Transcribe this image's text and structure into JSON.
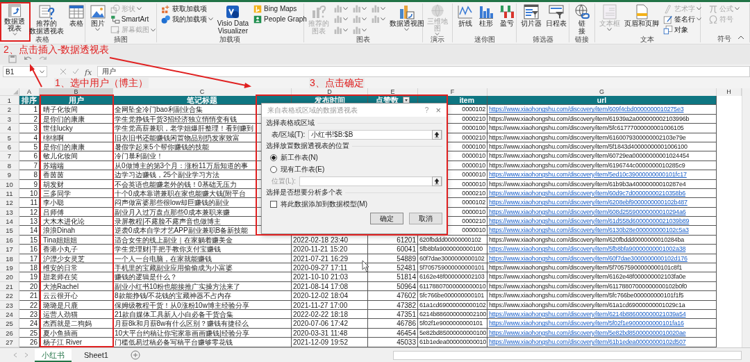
{
  "ribbon": {
    "groups": [
      {
        "label": "表格",
        "items": [
          {
            "kind": "large",
            "lines": [
              "数据透",
              "视表"
            ],
            "disabled": false,
            "menu": true
          },
          {
            "kind": "large",
            "lines": [
              "推荐的",
              "数据透视表"
            ],
            "disabled": false,
            "menu": false
          },
          {
            "kind": "large",
            "lines": [
              "表格"
            ],
            "disabled": false,
            "menu": false
          }
        ]
      },
      {
        "label": "插图",
        "items": [
          {
            "kind": "large",
            "lines": [
              "图片"
            ],
            "disabled": false,
            "menu": true
          },
          {
            "kind": "small",
            "label": "形状",
            "disabled": true,
            "menu": true
          },
          {
            "kind": "small",
            "label": "SmartArt",
            "disabled": false,
            "menu": false
          },
          {
            "kind": "small",
            "label": "屏幕截图",
            "disabled": true,
            "menu": true
          }
        ]
      },
      {
        "label": "加载项",
        "items": [
          {
            "kind": "small",
            "label": "获取加载项",
            "disabled": false,
            "menu": false
          },
          {
            "kind": "small",
            "label": "我的加载项",
            "disabled": false,
            "menu": true
          },
          {
            "kind": "large",
            "lines": [
              "Visio Data",
              "Visualizer"
            ],
            "disabled": false,
            "menu": false
          },
          {
            "kind": "small",
            "label": "Bing Maps",
            "disabled": false,
            "menu": false
          },
          {
            "kind": "small",
            "label": "People Graph",
            "disabled": false,
            "menu": false
          }
        ]
      },
      {
        "label": "图表",
        "items": [
          {
            "kind": "large",
            "lines": [
              "推荐的",
              "图表"
            ],
            "disabled": true,
            "menu": false
          },
          {
            "kind": "chart-menu",
            "disabled": true,
            "menu": true
          },
          {
            "kind": "chart-menu",
            "disabled": true,
            "menu": true
          },
          {
            "kind": "chart-menu",
            "disabled": true,
            "menu": true
          },
          {
            "kind": "chart-menu",
            "disabled": true,
            "menu": true
          },
          {
            "kind": "chart-menu",
            "disabled": true,
            "menu": true
          },
          {
            "kind": "chart-menu",
            "disabled": true,
            "menu": true
          },
          {
            "kind": "chart-menu",
            "disabled": true,
            "menu": true
          },
          {
            "kind": "chart-menu",
            "disabled": true,
            "menu": true
          },
          {
            "kind": "large",
            "lines": [
              "数据透视图"
            ],
            "disabled": false,
            "menu": true
          }
        ]
      },
      {
        "label": "演示",
        "items": [
          {
            "kind": "large",
            "lines": [
              "三维地",
              "图"
            ],
            "disabled": true,
            "menu": true
          }
        ]
      },
      {
        "label": "迷你图",
        "items": [
          {
            "kind": "large",
            "lines": [
              "折线"
            ],
            "disabled": false,
            "menu": false
          },
          {
            "kind": "large",
            "lines": [
              "柱形"
            ],
            "disabled": false,
            "menu": false
          },
          {
            "kind": "large",
            "lines": [
              "盈亏"
            ],
            "disabled": false,
            "menu": false
          }
        ]
      },
      {
        "label": "筛选器",
        "items": [
          {
            "kind": "large",
            "lines": [
              "切片器"
            ],
            "disabled": false,
            "menu": false
          },
          {
            "kind": "large",
            "lines": [
              "日程表"
            ],
            "disabled": false,
            "menu": false
          }
        ]
      },
      {
        "label": "链接",
        "items": [
          {
            "kind": "large",
            "lines": [
              "链",
              "接"
            ],
            "disabled": false,
            "menu": false
          }
        ]
      },
      {
        "label": "文本",
        "items": [
          {
            "kind": "large",
            "lines": [
              "文本框"
            ],
            "disabled": true,
            "menu": true
          },
          {
            "kind": "large",
            "lines": [
              "页眉和页脚"
            ],
            "disabled": false,
            "menu": false
          },
          {
            "kind": "small",
            "label": "艺术字",
            "disabled": true,
            "menu": true
          },
          {
            "kind": "small",
            "label": "签名行",
            "disabled": false,
            "menu": true
          },
          {
            "kind": "small",
            "label": "对象",
            "disabled": false,
            "menu": false
          }
        ]
      },
      {
        "label": "符号",
        "items": [
          {
            "kind": "small",
            "label": "公式",
            "disabled": true,
            "menu": true
          },
          {
            "kind": "small",
            "label": "符号",
            "disabled": true,
            "menu": false
          }
        ]
      }
    ]
  },
  "formula_bar": {
    "name_box": "B1",
    "function_label": "fx",
    "content": "用户"
  },
  "columns": [
    {
      "letter": "A",
      "selected": false
    },
    {
      "letter": "B",
      "selected": true
    },
    {
      "letter": "C",
      "selected": false
    },
    {
      "letter": "D",
      "selected": false
    },
    {
      "letter": "E",
      "selected": false
    },
    {
      "letter": "F",
      "selected": false
    },
    {
      "letter": "G",
      "selected": false
    },
    {
      "letter": "H",
      "selected": false
    }
  ],
  "header": {
    "num": "1",
    "rank": "排序",
    "user": "用户",
    "title": "笔记标题",
    "time": "发布时间",
    "likes": "点赞数",
    "item": "item",
    "url": "url"
  },
  "rows": [
    {
      "num": "2",
      "rank": "1",
      "user": "晴子化妆间",
      "title": "全网坠全冷门bao利副业合集",
      "item": "0000102",
      "url": "https://www.xiaohongshu.com/discovery/item/609f4cbd0000000010275e3",
      "link": true
    },
    {
      "num": "3",
      "rank": "2",
      "user": "是你们的康康",
      "title": "学生党挣钱干货3招经济独立悄悄变有钱",
      "item": "0000210",
      "url": "https://www.xiaohongshu.com/discovery/item/61939a2a000000002103996b",
      "link": false
    },
    {
      "num": "4",
      "rank": "3",
      "user": "世佳lucky",
      "title": "学生党高薪兼职，老学姐爆肝整理！看到赚到",
      "item": "0000100",
      "url": "https://www.xiaohongshu.com/discovery/item/5fc61777000000001006105",
      "link": false
    },
    {
      "num": "5",
      "rank": "4",
      "user": "绵绵啊",
      "title": "旧衣旧书还能赚钱闲置物品别扔发家致富",
      "item": "0000210",
      "url": "https://www.xiaohongshu.com/discovery/item/6160079300000002103e79e",
      "link": false
    },
    {
      "num": "6",
      "rank": "5",
      "user": "是你们的康康",
      "title": "暑假学起来5个帮你赚钱的技能",
      "item": "0000100",
      "url": "https://www.xiaohongshu.com/discovery/item/5f1843d40000000001006100",
      "link": false
    },
    {
      "num": "7",
      "rank": "6",
      "user": "敏儿化妆间",
      "title": "冷门暴利副业！",
      "item": "0000010",
      "url": "https://www.xiaohongshu.com/discovery/item/60729ea00000000001024454",
      "link": false
    },
    {
      "num": "8",
      "rank": "7",
      "user": "苏端端",
      "title": "从0做博主的第3个月：涨粉11万后知道的事",
      "item": "0000010",
      "url": "https://www.xiaohongshu.com/discovery/item/6196744c0000000010285c9",
      "link": false
    },
    {
      "num": "9",
      "rank": "8",
      "user": "香茵茵",
      "title": "边学习边赚钱，25个副业学习方法",
      "item": "0000010",
      "url": "https://www.xiaohongshu.com/discovery/item/5ed10c39000000000101fc17",
      "link": true
    },
    {
      "num": "10",
      "rank": "9",
      "user": "胡发财",
      "title": "不会英语也能赚老外的钱！0基础无压力",
      "item": "0000010",
      "url": "https://www.xiaohongshu.com/discovery/item/61b9b3a40000000010287e4",
      "link": false
    },
    {
      "num": "11",
      "rank": "10",
      "user": "三多同学",
      "title": "十个0成本靠谱兼职在家也能赚大钱(附平台",
      "item": "0000210",
      "url": "https://www.xiaohongshu.com/discovery/item/60d9c7d00000000210358b6",
      "link": true
    },
    {
      "num": "12",
      "rank": "11",
      "user": "李小聪",
      "title": "闷声做富婆那些很low却巨赚钱的副业",
      "item": "0000102",
      "url": "https://www.xiaohongshu.com/discovery/item/6208ebf9000000000102b487",
      "link": true
    },
    {
      "num": "13",
      "rank": "12",
      "user": "吕师傅",
      "title": "副业月入过万盘点那些0成本兼职来赚",
      "item": "0000010",
      "url": "https://www.xiaohongshu.com/discovery/item/608d25590000000010294a6",
      "link": true
    },
    {
      "num": "14",
      "rank": "13",
      "user": "大木木进化论",
      "title": "录屏教程|不露脸不露声音也做博主",
      "item": "0000210",
      "url": "https://www.xiaohongshu.com/discovery/item/61d558d60000000021039b89",
      "link": true
    },
    {
      "num": "15",
      "rank": "14",
      "user": "浪浪Dinah",
      "title": "逆袭0成本自学才艺APP副业兼职B备新技能",
      "item": "0000010",
      "url": "https://www.xiaohongshu.com/discovery/item/6130b28e000000000102c5a3",
      "link": true
    },
    {
      "num": "16",
      "rank": "15",
      "user": "Tina姐姐姐",
      "title": "适合女生的线上副业｜在家躺着赚美金",
      "time": "2022-02-18 23:40",
      "likes": "61201",
      "item": "620fbddd00000000102",
      "url": "https://www.xiaohongshu.com/discovery/item/620fbddd0000000010284ba",
      "link": false
    },
    {
      "num": "17",
      "rank": "16",
      "user": "香港小丸子",
      "title": "学生党理财|手把手教你支付宝赚钱",
      "time": "2020-11-21 15:20",
      "likes": "60041",
      "item": "5fb8bfa9000000000100",
      "url": "https://www.xiaohongshu.com/discovery/item/5fb8bfa90000000001002a38",
      "link": true
    },
    {
      "num": "18",
      "rank": "17",
      "user": "沪漂少女灵芝",
      "title": "一个人一台电脑，在家就能赚钱",
      "time": "2021-07-21 16:29",
      "likes": "54889",
      "item": "60f7dae3000000000102",
      "url": "https://www.xiaohongshu.com/discovery/item/60f7dae3000000000102d176",
      "link": true
    },
    {
      "num": "19",
      "rank": "18",
      "user": "维安的日常",
      "title": "手机里的宝藏副业应用偷偷成为小富婆",
      "time": "2020-09-27 17:11",
      "likes": "52481",
      "item": "5f705759000000000101",
      "url": "https://www.xiaohongshu.com/discovery/item/5f70575900000000101c8f1",
      "link": false
    },
    {
      "num": "20",
      "rank": "19",
      "user": "甜老师在笑",
      "title": "赚钱的逻辑是什么？",
      "time": "2021-10-10 21:03",
      "likes": "51814",
      "item": "6162e48f000000002103",
      "url": "https://www.xiaohongshu.com/discovery/item/6162e48f000000002103fa0e",
      "link": false
    },
    {
      "num": "21",
      "rank": "20",
      "user": "大池Rachel",
      "title": "副业小红书10粉也能接推广实操方法来了",
      "time": "2021-08-14 17:08",
      "likes": "50964",
      "item": "61178807000000000010",
      "url": "https://www.xiaohongshu.com/discovery/item/61178807000000000102b0f0",
      "link": false
    },
    {
      "num": "22",
      "rank": "21",
      "user": "云云很开心",
      "title": "8款能挣钱/不花钱的宝藏神器不占内存",
      "time": "2020-12-02 18:04",
      "likes": "47602",
      "item": "5fc766be000000000101",
      "url": "https://www.xiaohongshu.com/discovery/item/5fc766be000000000101f1f5",
      "link": false
    },
    {
      "num": "23",
      "rank": "22",
      "user": "璐璐是只鹿",
      "title": "保姆级教程干货！从0涨粉10w博主经验分享",
      "time": "2021-11-27 17:00",
      "likes": "47382",
      "item": "61a1cd69000000000102",
      "url": "https://www.xiaohongshu.com/discovery/item/61a1cd69000000001029c1a",
      "link": false
    },
    {
      "num": "24",
      "rank": "23",
      "user": "运营人劲猫",
      "title": "21款自媒体工具新人小白必备干货合集",
      "time": "2022-02-22 18:18",
      "likes": "47351",
      "item": "6214b886000000002100",
      "url": "https://www.xiaohongshu.com/discovery/item/6214b886000000021039a54",
      "link": true
    },
    {
      "num": "25",
      "rank": "24",
      "user": "杰西就是二狗妈",
      "title": "月薪8k和月薪8w有什么区别？赚钱有捷径么",
      "time": "2020-07-06 17:42",
      "likes": "46786",
      "item": "5f02f1e9000000000101",
      "url": "https://www.xiaohongshu.com/discovery/item/5f02f1e9000000000101fa16",
      "link": true
    },
    {
      "num": "26",
      "rank": "25",
      "user": "夏小鱼插画",
      "title": "10大平台约稿让你宅家靠画画赚钱|经验分享",
      "time": "2020-03-31 11:48",
      "likes": "46454",
      "item": "5e82bd85000000000100",
      "url": "https://www.xiaohongshu.com/discovery/item/5e82bd850000000010020ae",
      "link": true
    },
    {
      "num": "27",
      "rank": "26",
      "user": "杨子江 River",
      "title": "门槛低易过稿必备写稿平台赚够零花钱",
      "time": "2021-12-09 19:52",
      "likes": "45033",
      "item": "61b1edea000000000010",
      "url": "https://www.xiaohongshu.com/discovery/item/61b1edea00000000102d507",
      "link": true
    }
  ],
  "dialog": {
    "title": "来自表格或区域的数据透视表",
    "help": "?",
    "close": "×",
    "source_heading": "选择表格或区域",
    "range_label": "表/区域(T):",
    "range_value": "小红书!$B:$B",
    "location_heading": "选择放置数据透视表的位置",
    "options": [
      {
        "label": "新工作表(N)",
        "selected": true
      },
      {
        "label": "现有工作表(E)",
        "selected": false
      }
    ],
    "location_label": "位置(L):",
    "location_disabled": true,
    "multi_heading": "选择是否想要分析多个表",
    "model_checkbox": {
      "label": "将此数据添加到数据模型(M)",
      "checked": false
    },
    "buttons": [
      "确定",
      "取消"
    ]
  },
  "sheet_tabs": [
    {
      "label": "小红书",
      "selected": true
    },
    {
      "label": "Sheet1",
      "selected": false
    }
  ],
  "annotations": [
    {
      "text": "2、点击插入-数据透视表"
    },
    {
      "text": "1、选中用户（博主）"
    },
    {
      "text": "3、点击确定"
    }
  ]
}
